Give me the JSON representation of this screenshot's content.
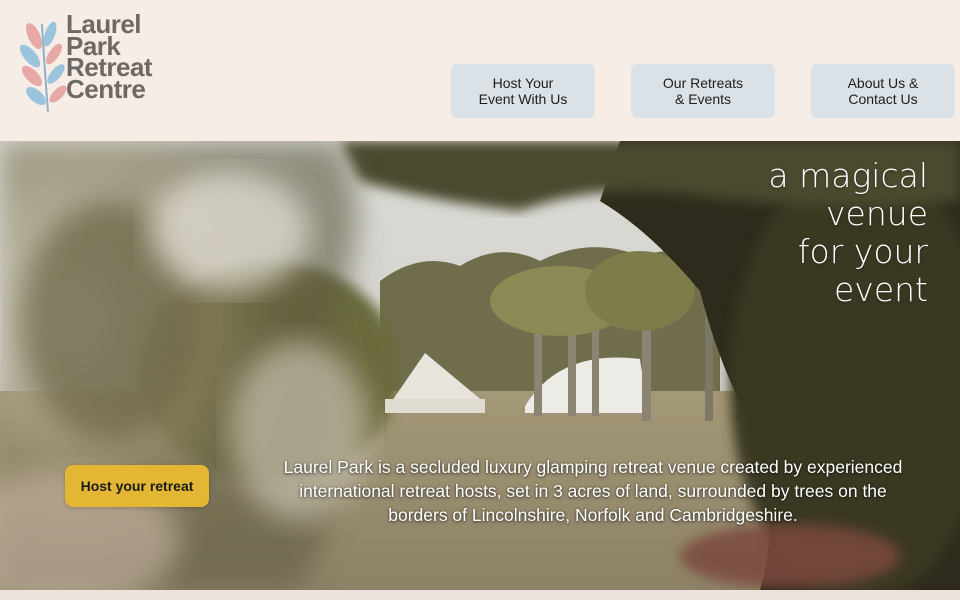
{
  "header": {
    "logo_lines": [
      "Laurel",
      "Park",
      "Retreat",
      "Centre"
    ],
    "nav": [
      {
        "line1": "Host Your",
        "line2": "Event With Us"
      },
      {
        "line1": "Our Retreats",
        "line2": "& Events"
      },
      {
        "line1": "About Us &",
        "line2": "Contact Us"
      }
    ]
  },
  "hero": {
    "tagline": [
      "a magical",
      "venue",
      "for your",
      "event"
    ],
    "cta_label": "Host your retreat",
    "description": "Laurel Park is a secluded luxury glamping retreat venue created by experienced international retreat hosts, set in 3 acres of land, surrounded by trees on the borders of Lincolnshire, Norfolk and Cambridgeshire."
  },
  "colors": {
    "background": "#f5ede6",
    "nav_button": "#dbe2e7",
    "cta": "#e3b733",
    "logo_text": "#6f6966"
  },
  "icons": {
    "logo_mark": "leaf-sprig-icon"
  }
}
